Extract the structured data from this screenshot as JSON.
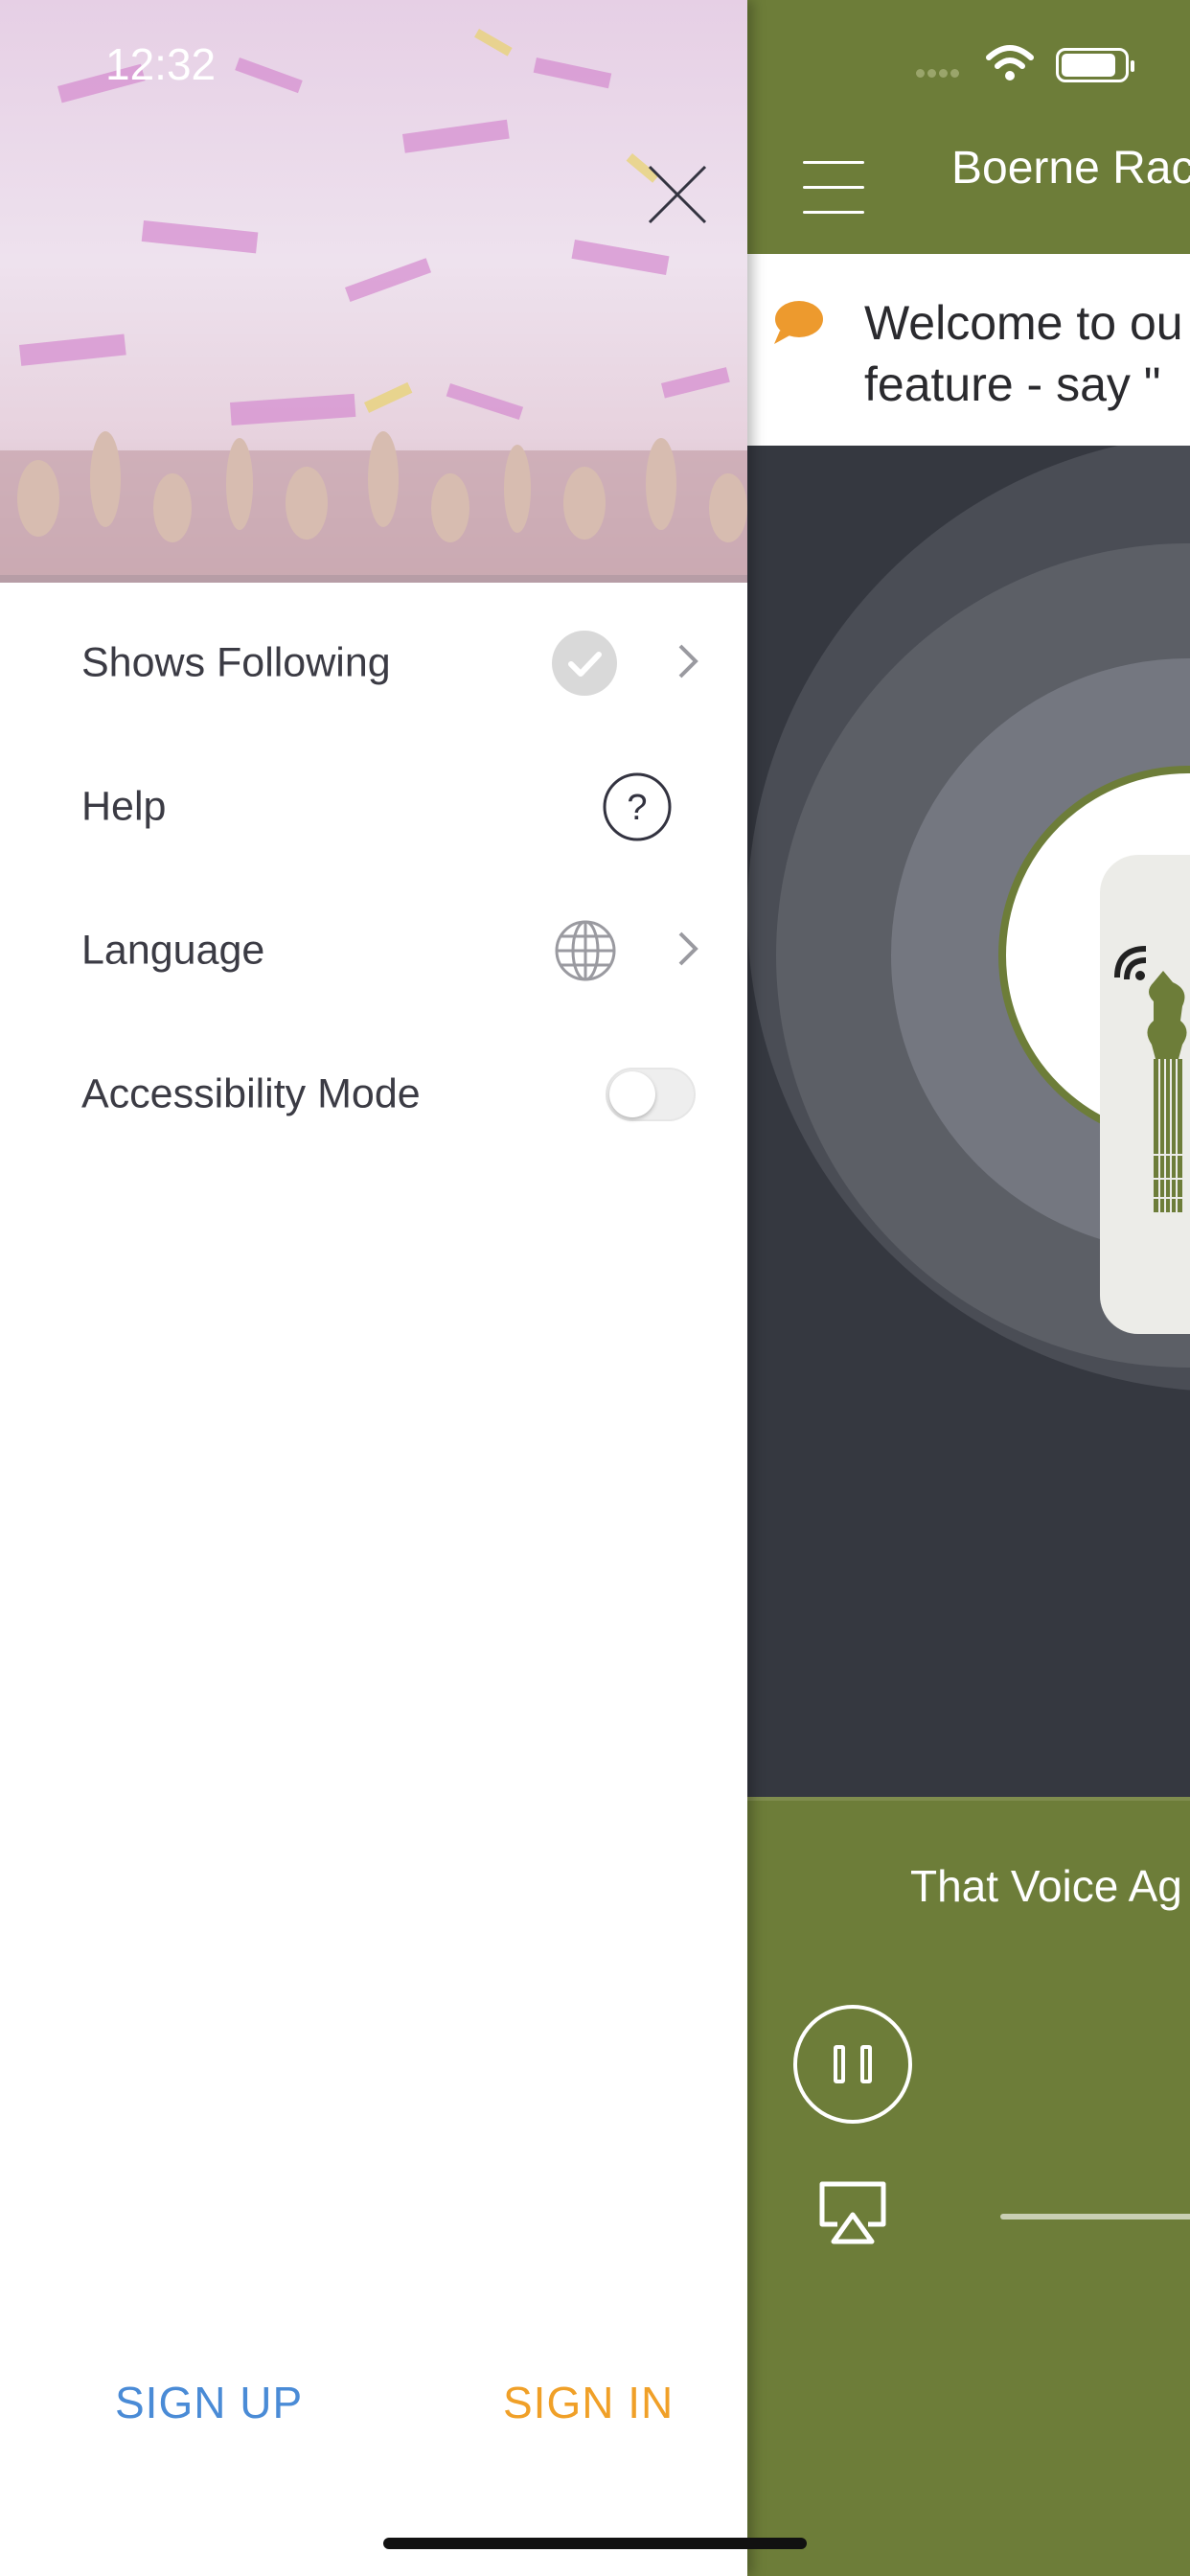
{
  "status_bar": {
    "time": "12:32"
  },
  "app": {
    "title": "Boerne Rac",
    "banner_text": "Welcome to ou\nfeature - say \"",
    "now_playing": "That Voice Ag",
    "colors": {
      "header": "#6d7d39",
      "artwork_bg": "#353840",
      "banner_icon": "#ed9a2e"
    }
  },
  "drawer": {
    "menu_items": [
      {
        "label": "Shows Following",
        "icon": "check-circle-icon",
        "has_chevron": true
      },
      {
        "label": "Help",
        "icon": "question-circle-icon",
        "has_chevron": false
      },
      {
        "label": "Language",
        "icon": "globe-icon",
        "has_chevron": true
      },
      {
        "label": "Accessibility Mode",
        "icon": "toggle-switch",
        "toggle_on": false
      }
    ],
    "sign_up_label": "SIGN UP",
    "sign_in_label": "SIGN IN",
    "colors": {
      "sign_up": "#4a8bd6",
      "sign_in": "#f0a028"
    }
  }
}
